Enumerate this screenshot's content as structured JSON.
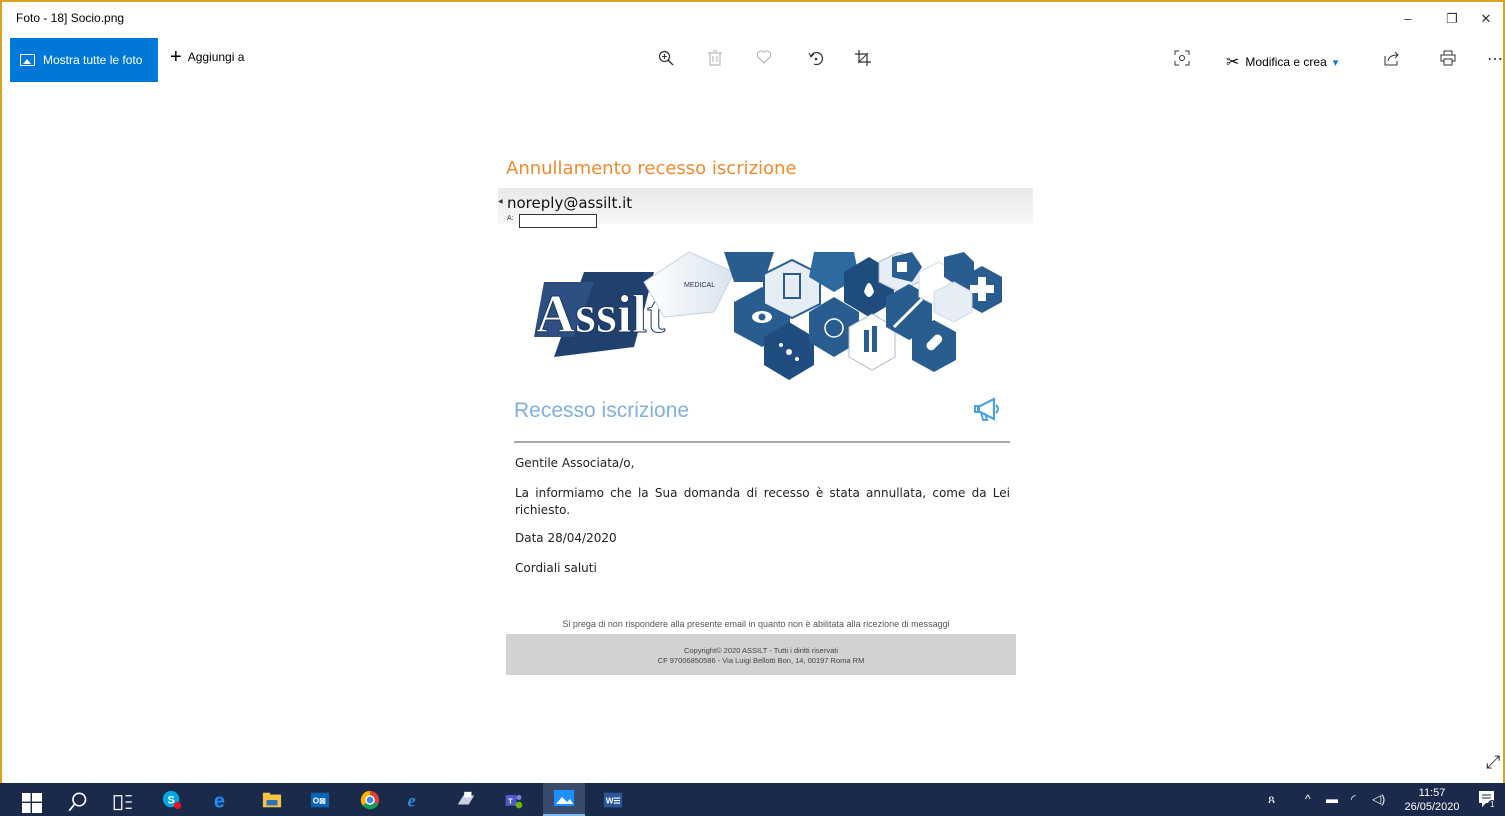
{
  "window": {
    "title": "Foto - 18] Socio.png",
    "controls": {
      "minimize": "–",
      "restore": "❐",
      "close": "✕"
    }
  },
  "toolbar": {
    "show_all_label": "Mostra tutte le foto",
    "add_to_label": "Aggiungi a",
    "edit_create_label": "Modifica e crea",
    "icons": [
      "zoom-in-icon",
      "delete-icon",
      "favorite-icon",
      "rotate-icon",
      "crop-icon",
      "enhance-icon",
      "share-icon",
      "print-icon",
      "more-icon"
    ]
  },
  "email": {
    "subject": "Annullamento recesso iscrizione",
    "sender": "noreply@assilt.it",
    "to_label": "A:",
    "banner": {
      "logo_text": "Assilt",
      "medical_label": "MEDICAL"
    },
    "section_title": "Recesso iscrizione",
    "greeting": "Gentile Associata/o,",
    "paragraph": "La informiamo che la Sua domanda di recesso è stata annullata, come da Lei richiesto.",
    "date_line": "Data 28/04/2020",
    "closing": "Cordiali saluti",
    "footer_note": "Si prega di non rispondere alla presente email in quanto non è abilitata alla ricezione di messaggi",
    "copyright_line1": "Copyright© 2020 ASSILT - Tutti i diritti riservati",
    "copyright_line2": "CF 97006850586 - Via Luigi Bellotti Bon, 14, 00197 Roma RM"
  },
  "taskbar": {
    "time": "11:57",
    "date": "26/05/2020",
    "notification_count": "1",
    "colors": {
      "background": "#1b2a4a",
      "accent": "#0078d7"
    }
  }
}
